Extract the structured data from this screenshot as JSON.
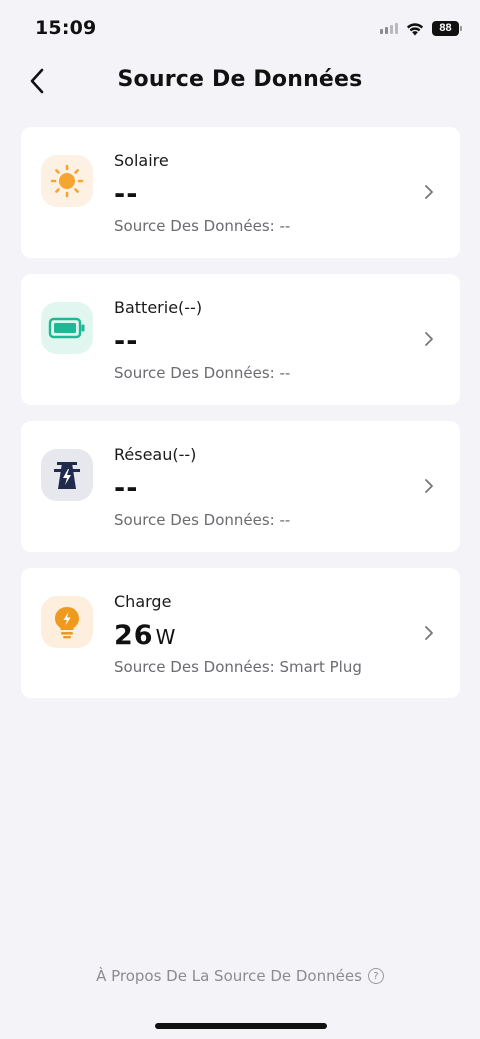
{
  "status_bar": {
    "time": "15:09",
    "battery": "88"
  },
  "header": {
    "title": "Source De Données"
  },
  "cards": [
    {
      "name": "Solaire",
      "value": "--",
      "unit": "",
      "source": "Source Des Données: --",
      "icon": "sun-icon",
      "icon_bg": "#fdf1e4"
    },
    {
      "name": "Batterie(--)",
      "value": "--",
      "unit": "",
      "source": "Source Des Données: --",
      "icon": "battery-icon",
      "icon_bg": "#e2f6f0"
    },
    {
      "name": "Réseau(--)",
      "value": "--",
      "unit": "",
      "source": "Source Des Données: --",
      "icon": "grid-tower-icon",
      "icon_bg": "#e6e8ee"
    },
    {
      "name": "Charge",
      "value": "26",
      "unit": "W",
      "source": "Source Des Données: Smart Plug",
      "icon": "bulb-icon",
      "icon_bg": "#fdeedd"
    }
  ],
  "footer": {
    "link": "À Propos De La Source De Données"
  },
  "colors": {
    "solar": "#f7a531",
    "battery": "#1fb894",
    "grid": "#1f2a4d",
    "load": "#ee9a1f"
  }
}
